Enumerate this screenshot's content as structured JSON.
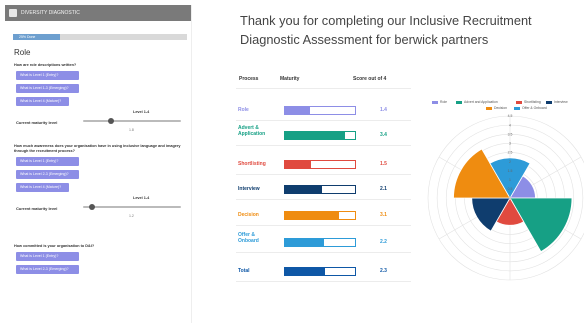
{
  "left_panel": {
    "header_text": "DIVERSITY DIAGNOSTIC",
    "progress": {
      "label": "25% Done",
      "value": 0.27
    },
    "section_title": "Role",
    "questions": [
      {
        "text": "How are role descriptions written?",
        "levels": [
          "What is Level 1 (Entry)?",
          "What is Level 1-3 (Emerging)?",
          "What is Level 4 (Mature)?"
        ]
      },
      {
        "text": "How much awareness does your organisation have in using inclusive language and imagery through the recruitment process?",
        "levels": [
          "What is Level 1 (Entry)?",
          "What is Level 2-3 (Emerging)?",
          "What is Level 4 (Mature)?"
        ]
      },
      {
        "text": "How committed is your organisation to D&I?",
        "levels": [
          "What is Level 1 (Entry)?",
          "What is Level 2-3 (Emerging)?"
        ]
      }
    ],
    "sliders": [
      {
        "range_label": "Level 1-4",
        "label": "Current maturity level",
        "value": "1.8",
        "level": 1.8
      },
      {
        "range_label": "Level 1-4",
        "label": "Current maturity level",
        "value": "1.2",
        "level": 1.2
      }
    ]
  },
  "results": {
    "title": "Thank you for completing our Inclusive Recruitment Diagnostic Assessment for berwick partners",
    "headers": {
      "process": "Process",
      "maturity": "Maturity",
      "score": "Score out of 4"
    },
    "rows": [
      {
        "name": "Role",
        "score": "1.4",
        "value": 1.4,
        "color": "#8d8ee6"
      },
      {
        "name": "Advert & Application",
        "score": "3.4",
        "value": 3.4,
        "color": "#16a085"
      },
      {
        "name": "Shortlisting",
        "score": "1.5",
        "value": 1.5,
        "color": "#e04a3f"
      },
      {
        "name": "Interview",
        "score": "2.1",
        "value": 2.1,
        "color": "#0f3d6e"
      },
      {
        "name": "Decision",
        "score": "3.1",
        "value": 3.1,
        "color": "#ef8c10"
      },
      {
        "name": "Offer & Onboard",
        "score": "2.2",
        "value": 2.2,
        "color": "#2d9bd8"
      },
      {
        "name": "Total",
        "score": "2.3",
        "value": 2.3,
        "color": "#0e57a6"
      }
    ]
  },
  "chart_data": {
    "type": "polar-area",
    "series": [
      {
        "name": "Role",
        "value": 1.4,
        "color": "#8d8ee6"
      },
      {
        "name": "Advert and Application",
        "value": 3.4,
        "color": "#16a085"
      },
      {
        "name": "Shortlisting",
        "value": 1.5,
        "color": "#e04a3f"
      },
      {
        "name": "Interview",
        "value": 2.1,
        "color": "#0f3d6e"
      },
      {
        "name": "Decision",
        "value": 3.1,
        "color": "#ef8c10"
      },
      {
        "name": "Offer & Onboard",
        "value": 2.2,
        "color": "#2d9bd8"
      }
    ],
    "ticks": [
      "0",
      "0.5",
      "1",
      "1.5",
      "2",
      "2.5",
      "3",
      "3.5",
      "4",
      "4.5"
    ],
    "rmax": 4.5,
    "grid": true,
    "legend_position": "top"
  }
}
